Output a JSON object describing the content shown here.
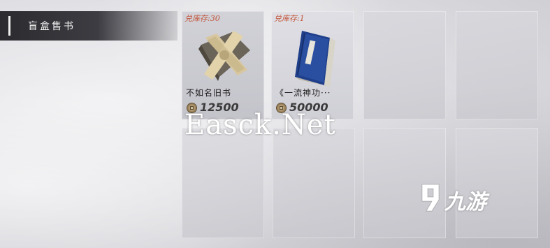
{
  "header": {
    "title": "盲盒售书"
  },
  "items": [
    {
      "stock": "兑库存:30",
      "name": "不如名旧书",
      "price": "12500",
      "icon": "wrapped-book-bundle"
    },
    {
      "stock": "兑库存:1",
      "name": "《一流神功···",
      "price": "50000",
      "icon": "blue-book"
    }
  ],
  "empty_slots": 6,
  "watermark": "Easck.Net",
  "logo": {
    "text": "九游"
  }
}
